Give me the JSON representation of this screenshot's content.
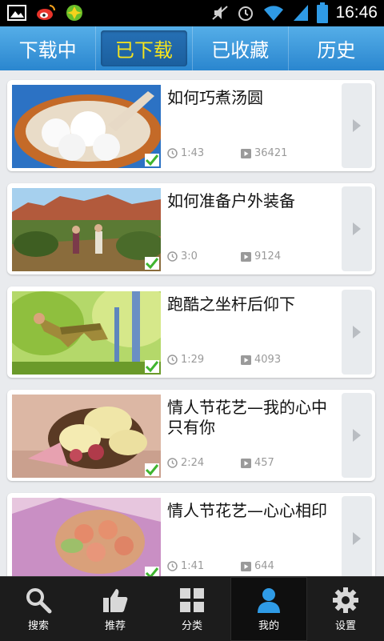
{
  "status_bar": {
    "time": "16:46",
    "left_icons": [
      "gallery-icon",
      "weibo-icon",
      "app-icon"
    ],
    "right_icons": [
      "mute-icon",
      "alarm-icon",
      "wifi-icon",
      "signal-icon",
      "battery-icon"
    ]
  },
  "tabs": [
    {
      "label": "下载中",
      "active": false
    },
    {
      "label": "已下载",
      "active": true
    },
    {
      "label": "已收藏",
      "active": false
    },
    {
      "label": "历史",
      "active": false
    }
  ],
  "videos": [
    {
      "title": "如何巧煮汤圆",
      "duration": "1:43",
      "plays": "36421"
    },
    {
      "title": "如何准备户外装备",
      "duration": "3:0",
      "plays": "9124"
    },
    {
      "title": "跑酷之坐杆后仰下",
      "duration": "1:29",
      "plays": "4093"
    },
    {
      "title": "情人节花艺—我的心中只有你",
      "duration": "2:24",
      "plays": "457"
    },
    {
      "title": "情人节花艺—心心相印",
      "duration": "1:41",
      "plays": "644"
    }
  ],
  "bottom_nav": [
    {
      "label": "搜索",
      "icon": "search-icon",
      "active": false
    },
    {
      "label": "推荐",
      "icon": "thumbs-up-icon",
      "active": false
    },
    {
      "label": "分类",
      "icon": "grid-icon",
      "active": false
    },
    {
      "label": "我的",
      "icon": "user-icon",
      "active": true
    },
    {
      "label": "设置",
      "icon": "gear-icon",
      "active": false
    }
  ],
  "colors": {
    "accent": "#2a86cf",
    "active_tab_text": "#f7e51c",
    "check": "#3fb52f"
  }
}
